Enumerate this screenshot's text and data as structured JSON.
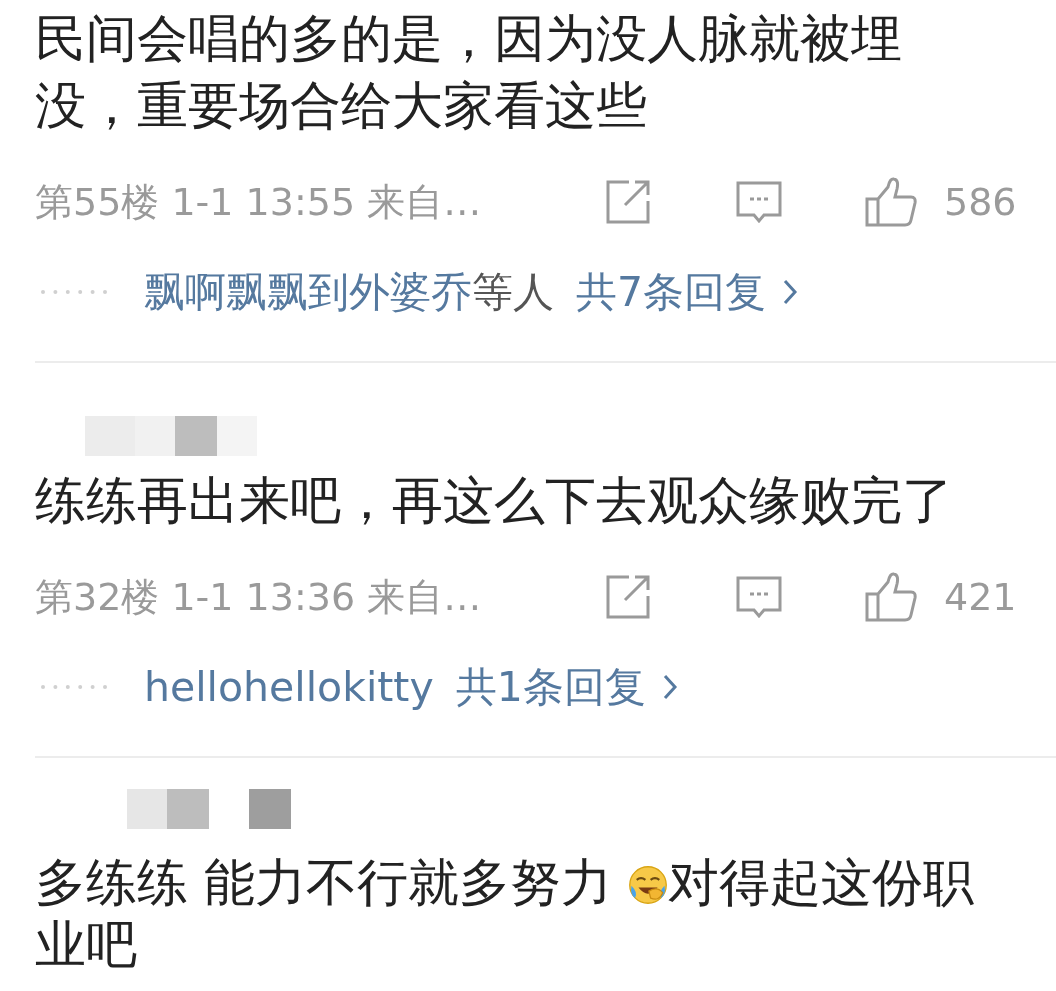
{
  "comments": [
    {
      "name_blurred": false,
      "body": [
        {
          "kind": "text",
          "text": "民间会唱的多的是，因为没人脉就被埋没，重要场合给大家看这些"
        }
      ],
      "floor": "第55楼 1-1 13:55 来自…",
      "likes": "586",
      "reply": {
        "users": "飘啊飘飘到外婆乔",
        "suffix": "等人",
        "total": "共7条回复"
      }
    },
    {
      "name_blurred": true,
      "body": [
        {
          "kind": "text",
          "text": "练练再出来吧，再这么下去观众缘败完了"
        }
      ],
      "floor": "第32楼 1-1 13:36 来自…",
      "likes": "421",
      "reply": {
        "users": "hellohellokitty",
        "total": "共1条回复"
      }
    },
    {
      "name_blurred": true,
      "body": [
        {
          "kind": "text",
          "text": "多练练 能力不行就多努力 "
        },
        {
          "kind": "emoji"
        },
        {
          "kind": "text",
          "text": "对得起这份职业吧"
        }
      ]
    }
  ]
}
